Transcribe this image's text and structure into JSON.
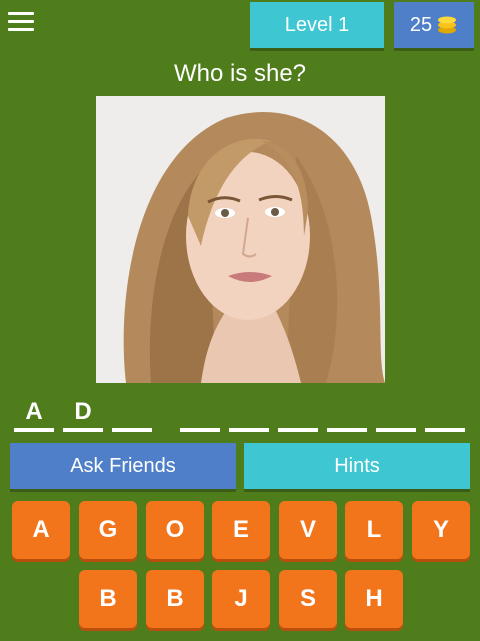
{
  "header": {
    "level_label": "Level 1",
    "coins": "25",
    "menu_icon": "hamburger-icon",
    "coin_icon": "coins-icon"
  },
  "question": "Who is she?",
  "answer": {
    "slots": [
      "A",
      "D",
      "",
      "",
      "",
      "",
      "",
      "",
      ""
    ]
  },
  "buttons": {
    "ask_friends": "Ask Friends",
    "hints": "Hints"
  },
  "keyboard": {
    "row1": [
      "A",
      "G",
      "O",
      "E",
      "V",
      "L",
      "Y"
    ],
    "row2": [
      "B",
      "B",
      "J",
      "S",
      "H"
    ]
  },
  "colors": {
    "background": "#4f7d1c",
    "cyan": "#3ec7d2",
    "blue": "#4e7fc8",
    "key_orange": "#f2741b"
  }
}
